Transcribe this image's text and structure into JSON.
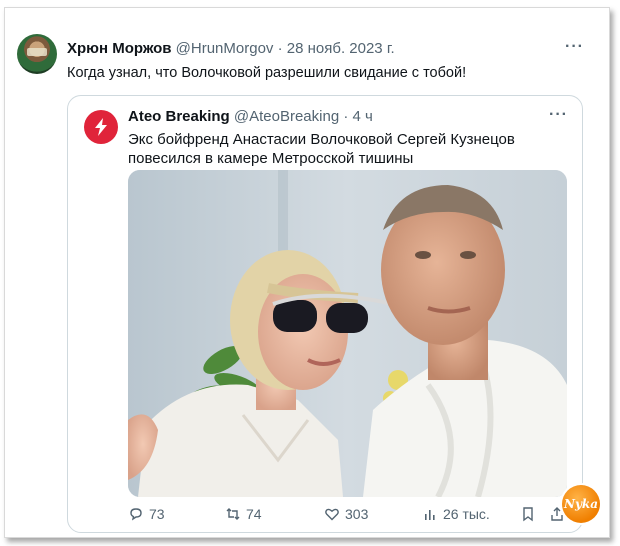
{
  "tweet": {
    "author_name": "Хрюн Моржов",
    "author_handle": "@HrunMorgov",
    "date": "· 28 нояб. 2023 г.",
    "more": "···",
    "text": "Когда узнал, что Волочковой разрешили свидание с тобой!"
  },
  "quoted": {
    "author_name": "Ateo Breaking",
    "author_handle": "@AteoBreaking",
    "date": "· 4 ч",
    "more": "···",
    "text": "Экс бойфренд Анастасии Волочковой Сергей Кузнецов повесился в камере Метросской тишины",
    "accent_color": "#e0243a"
  },
  "actions": {
    "replies": "73",
    "retweets": "74",
    "likes": "303",
    "views": "26 тыс."
  },
  "watermark": "Nyka"
}
